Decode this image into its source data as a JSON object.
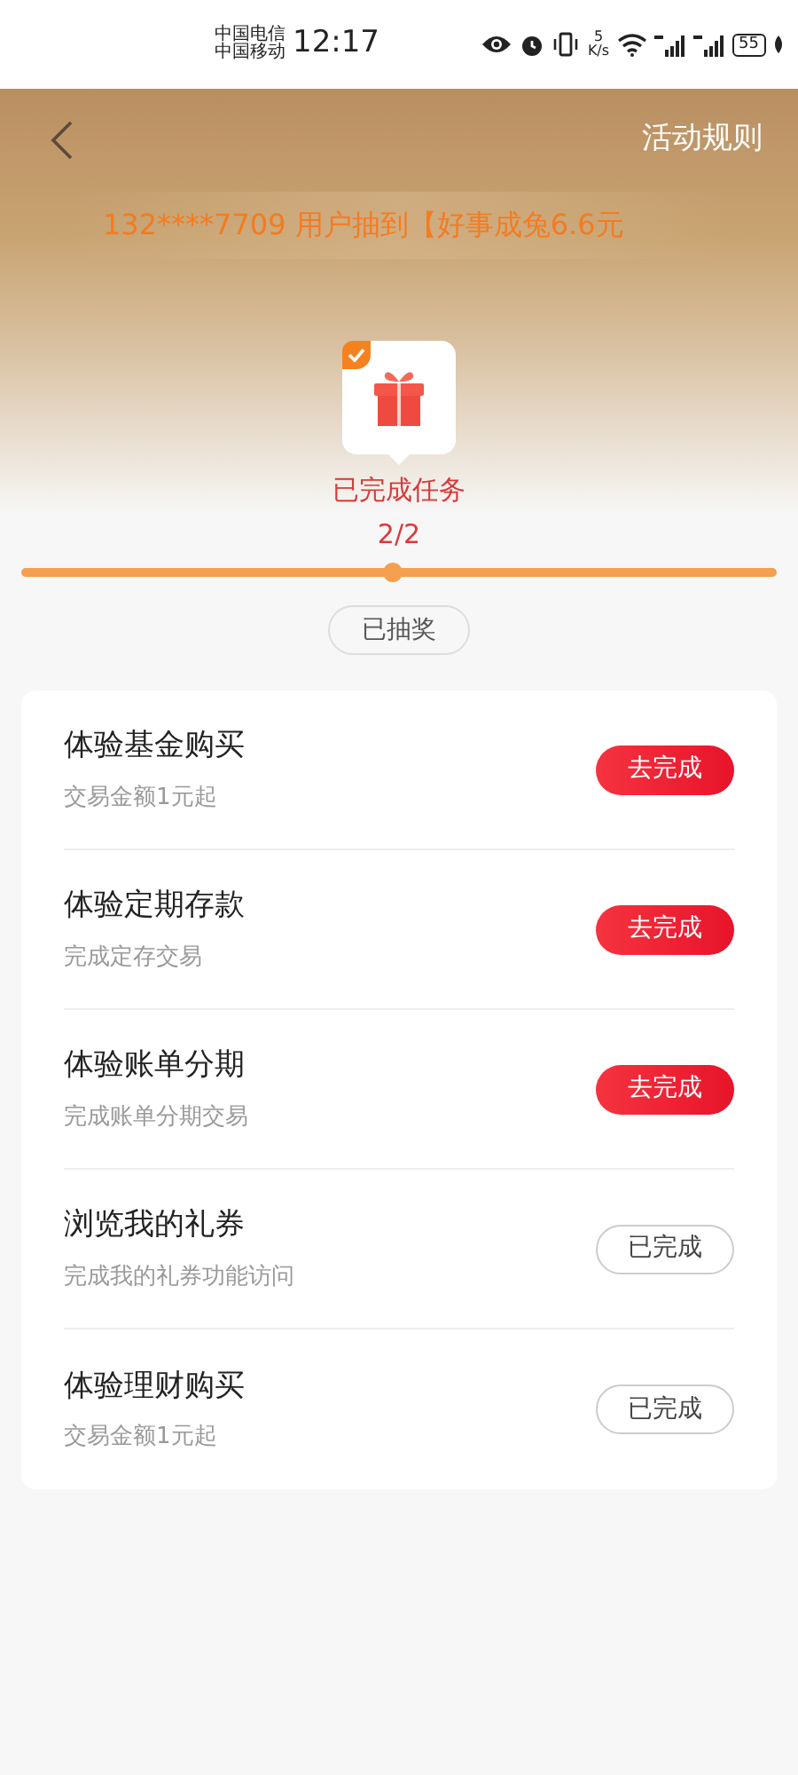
{
  "status_bar": {
    "carriers": [
      "中国电信",
      "中国移动"
    ],
    "time": "12:17",
    "speed_value": "5",
    "speed_unit": "K/s",
    "battery": "55"
  },
  "header": {
    "rules_link": "活动规则",
    "ticker": "132****7709 用户抽到【好事成兔6.6元"
  },
  "progress": {
    "checked": true,
    "label": "已完成任务",
    "count": "2/2",
    "level": 1,
    "draw_button": "已抽奖"
  },
  "tasks": [
    {
      "title": "体验基金购买",
      "subtitle": "交易金额1元起",
      "button": "去完成",
      "done": false
    },
    {
      "title": "体验定期存款",
      "subtitle": "完成定存交易",
      "button": "去完成",
      "done": false
    },
    {
      "title": "体验账单分期",
      "subtitle": "完成账单分期交易",
      "button": "去完成",
      "done": false
    },
    {
      "title": "浏览我的礼券",
      "subtitle": "完成我的礼券功能访问",
      "button": "已完成",
      "done": true
    },
    {
      "title": "体验理财购买",
      "subtitle": "交易金额1元起",
      "button": "已完成",
      "done": true
    }
  ]
}
